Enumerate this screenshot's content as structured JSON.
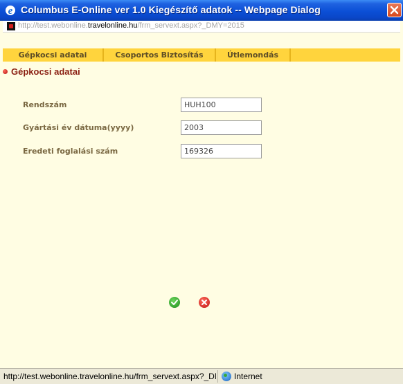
{
  "window": {
    "title": "Columbus E-Online ver 1.0 Kiegészítő adatok -- Webpage Dialog"
  },
  "address": {
    "url_prefix": "http://test.webonline.",
    "url_domain": "travelonline.hu",
    "url_suffix": "/frm_servext.aspx?_DMY=2015"
  },
  "tabs": [
    {
      "label": "Gépkocsi adatai"
    },
    {
      "label": "Csoportos Biztosítás"
    },
    {
      "label": "Útlemondás"
    }
  ],
  "section": {
    "title": "Gépkocsi adatai"
  },
  "form": {
    "fields": [
      {
        "label": "Rendszám",
        "value": "HUH100"
      },
      {
        "label": "Gyártási év dátuma(yyyy)",
        "value": "2003"
      },
      {
        "label": "Eredeti foglalási szám",
        "value": "169326"
      }
    ]
  },
  "actions": {
    "ok_icon": "check-icon",
    "cancel_icon": "cross-icon"
  },
  "status": {
    "url": "http://test.webonline.travelonline.hu/frm_servext.aspx?_DMY=20",
    "zone": "Internet"
  },
  "colors": {
    "titlebar": "#0b4fd6",
    "tab_bar": "#ffd43d",
    "panel_bg": "#fffde3",
    "section_title": "#8a1f12"
  }
}
